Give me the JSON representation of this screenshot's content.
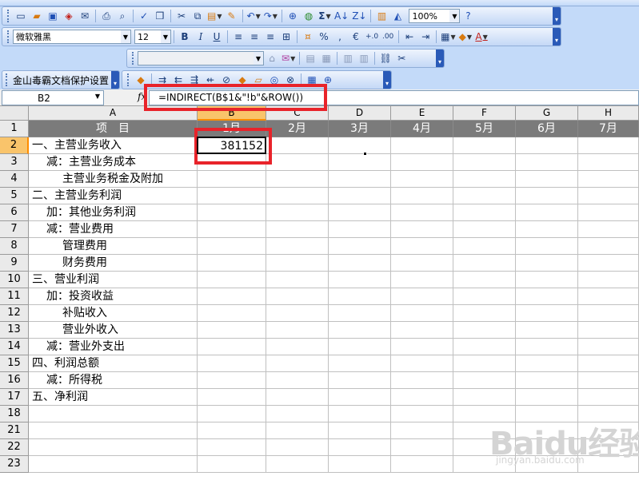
{
  "toolbar1": {
    "buttons": [
      "new-icon",
      "open-icon",
      "save-icon",
      "permission-icon",
      "email-icon",
      "print-icon",
      "print-preview-icon",
      "spelling-icon",
      "research-icon",
      "cut-icon",
      "copy-icon",
      "paste-icon",
      "format-painter-icon",
      "undo-icon",
      "redo-icon",
      "hyperlink-icon",
      "autosum-icon",
      "sort-ascending-icon",
      "sort-descending-icon",
      "chart-wizard-icon",
      "drawing-icon",
      "help-icon"
    ],
    "zoom": "100%"
  },
  "toolbar2": {
    "font": "微软雅黑",
    "size": "12",
    "bold": "B",
    "italic": "I",
    "underline": "U",
    "percent": "%",
    "comma": ",",
    "euro": "€"
  },
  "toolbar4": {
    "label": "金山毒霸文档保护设置"
  },
  "formula_bar": {
    "name_box": "B2",
    "fx": "fx",
    "formula": "=INDIRECT(B$1&\"!b\"&ROW())"
  },
  "columns": [
    "A",
    "B",
    "C",
    "D",
    "E",
    "F",
    "G",
    "H"
  ],
  "row_numbers": [
    "1",
    "2",
    "3",
    "4",
    "5",
    "6",
    "7",
    "8",
    "9",
    "10",
    "11",
    "12",
    "13",
    "14",
    "15",
    "16",
    "17",
    "18",
    "21",
    "22",
    "23"
  ],
  "header_row": [
    "项　目",
    "1月",
    "2月",
    "3月",
    "4月",
    "5月",
    "6月",
    "7月"
  ],
  "row_labels": [
    "一、主营业务收入",
    "减：主营业务成本",
    "主营业务税金及附加",
    "二、主营业务利润",
    "加：其他业务利润",
    "减：营业费用",
    "管理费用",
    "财务费用",
    "三、营业利润",
    "加：投资收益",
    "补贴收入",
    "营业外收入",
    "减：营业外支出",
    "四、利润总额",
    "减：所得税",
    "五、净利润"
  ],
  "active_cell_value": "381152",
  "watermark": {
    "logo": "Baidu经验",
    "url": "jingyan.baidu.com"
  },
  "colors": {
    "highlight": "#e8232a",
    "header_fill": "#7b7b7b",
    "selected_header": "#f9c46b"
  }
}
